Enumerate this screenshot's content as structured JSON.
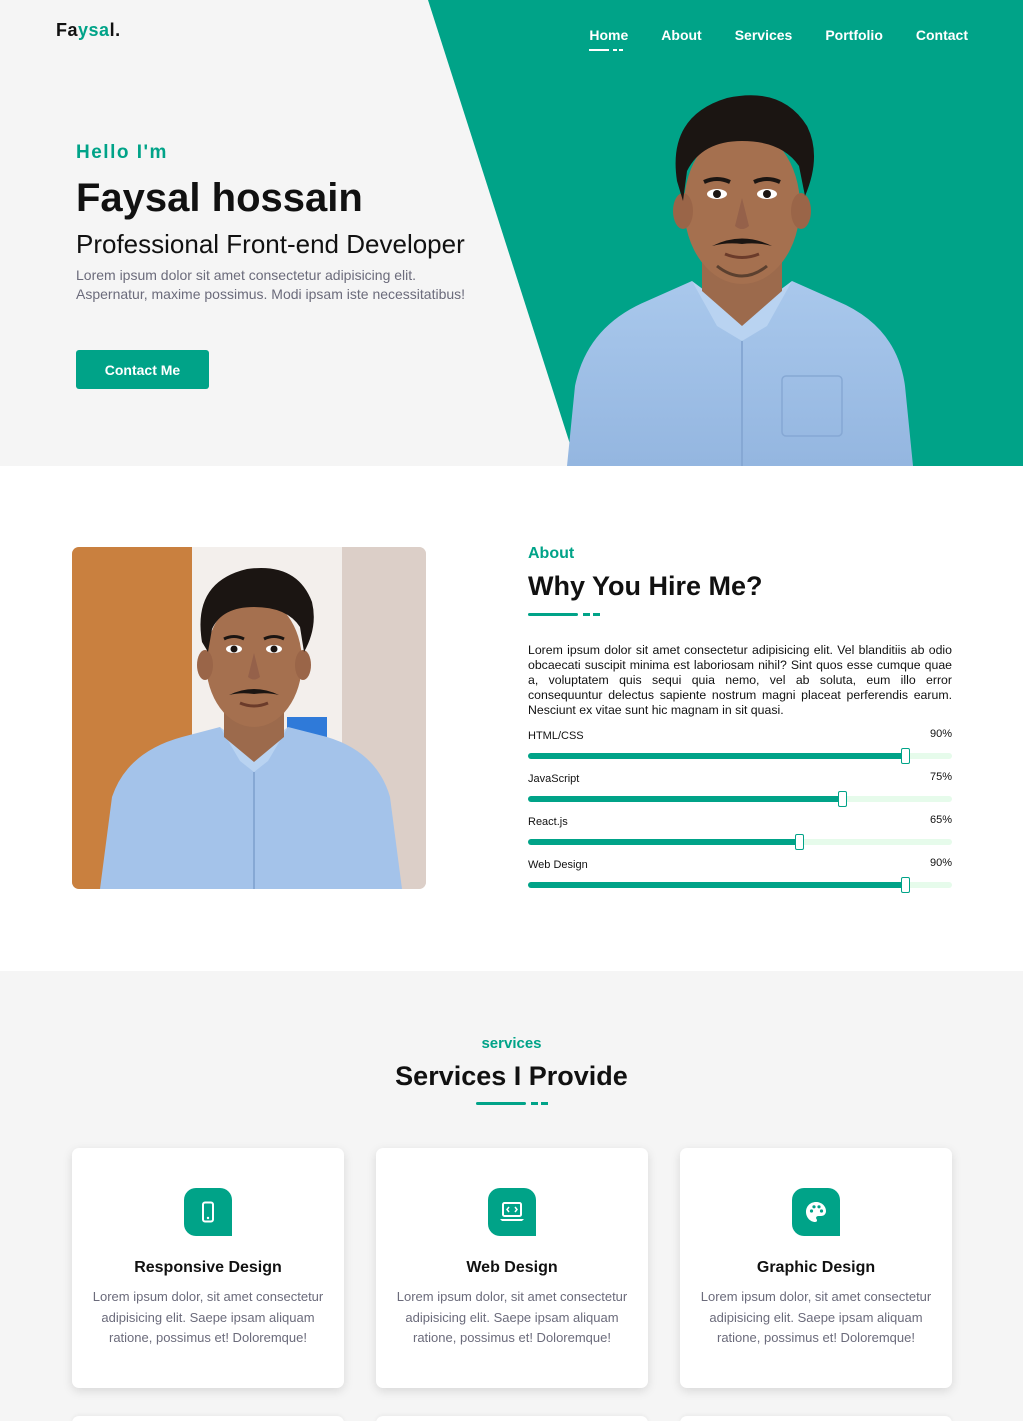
{
  "brand": {
    "prefix": "Fa",
    "accent": "ysa",
    "suffix": "l."
  },
  "nav": {
    "items": [
      "Home",
      "About",
      "Services",
      "Portfolio",
      "Contact"
    ],
    "active": "Home"
  },
  "hero": {
    "greeting": "Hello I'm",
    "name": "Faysal hossain",
    "role": "Professional Front-end Developer",
    "description": "Lorem ipsum dolor sit amet consectetur adipisicing elit. Aspernatur, maxime possimus. Modi ipsam iste necessitatibus!",
    "cta": "Contact Me"
  },
  "about": {
    "label": "About",
    "title": "Why You Hire Me?",
    "text": "Lorem ipsum dolor sit amet consectetur adipisicing elit. Vel blanditiis ab odio obcaecati suscipit minima est laboriosam nihil? Sint quos esse cumque quae a, voluptatem quis sequi quia nemo, vel ab soluta, eum illo error consequuntur delectus sapiente nostrum magni placeat perferendis earum. Nesciunt ex vitae sunt hic magnam in sit quasi.",
    "skills": [
      {
        "name": "HTML/CSS",
        "percent_label": "90%",
        "level": 0.89
      },
      {
        "name": "JavaScript",
        "percent_label": "75%",
        "level": 0.74
      },
      {
        "name": "React.js",
        "percent_label": "65%",
        "level": 0.64
      },
      {
        "name": "Web Design",
        "percent_label": "90%",
        "level": 0.89
      }
    ]
  },
  "services": {
    "label": "services",
    "title": "Services I Provide",
    "cards": [
      {
        "icon": "mobile-icon",
        "title": "Responsive Design",
        "text": "Lorem ipsum dolor, sit amet consectetur adipisicing elit. Saepe ipsam aliquam ratione, possimus et! Doloremque!"
      },
      {
        "icon": "laptop-code-icon",
        "title": "Web Design",
        "text": "Lorem ipsum dolor, sit amet consectetur adipisicing elit. Saepe ipsam aliquam ratione, possimus et! Doloremque!"
      },
      {
        "icon": "palette-icon",
        "title": "Graphic Design",
        "text": "Lorem ipsum dolor, sit amet consectetur adipisicing elit. Saepe ipsam aliquam ratione, possimus et! Doloremque!"
      }
    ]
  },
  "colors": {
    "accent": "#00a388",
    "hero_bg": "#f5f5f5",
    "track": "#e6fbeb",
    "text_muted": "#6b6b7b"
  }
}
